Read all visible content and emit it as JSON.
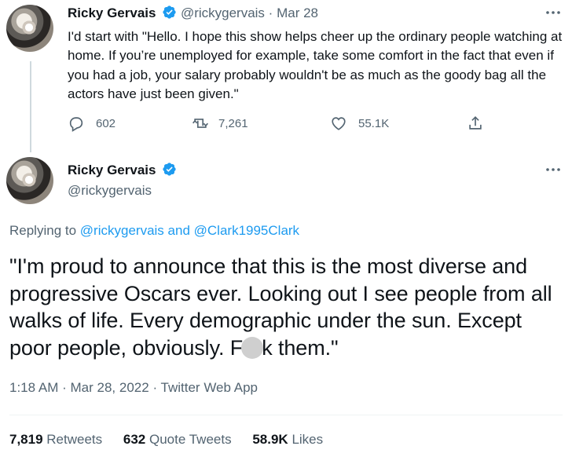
{
  "tweet1": {
    "name": "Ricky Gervais",
    "handle": "@rickygervais",
    "separator": "·",
    "date": "Mar 28",
    "text": "I'd start with \"Hello. I hope this show helps cheer up the ordinary people watching at home. If you’re unemployed for example, take some comfort in the fact that even if you had a job, your salary probably wouldn't be as much as the goody bag all the actors have just been given.\"",
    "replies": "602",
    "retweets": "7,261",
    "likes": "55.1K"
  },
  "tweet2": {
    "name": "Ricky Gervais",
    "handle": "@rickygervais",
    "replying_prefix": "Replying to",
    "replying_user1": "@rickygervais",
    "replying_and": "and",
    "replying_user2": "@Clark1995Clark",
    "text_before": "\"I'm proud to announce that this is the most diverse and progressive Oscars ever. Looking out I see people from all walks of life. Every demographic under the sun. Except poor people, obviously. F",
    "text_after": "k them.\"",
    "time": "1:18 AM",
    "meta_sep1": "·",
    "date": "Mar 28, 2022",
    "meta_sep2": "·",
    "source": "Twitter Web App",
    "stats": {
      "retweets_count": "7,819",
      "retweets_label": "Retweets",
      "quote_count": "632",
      "quote_label": "Quote Tweets",
      "likes_count": "58.9K",
      "likes_label": "Likes"
    }
  },
  "colors": {
    "accent": "#1d9bf0",
    "text": "#0f1419",
    "muted": "#536471",
    "divider": "#eff3f4"
  },
  "icons": [
    "verified-badge-icon",
    "more-icon",
    "reply-icon",
    "retweet-icon",
    "like-icon",
    "share-icon"
  ]
}
